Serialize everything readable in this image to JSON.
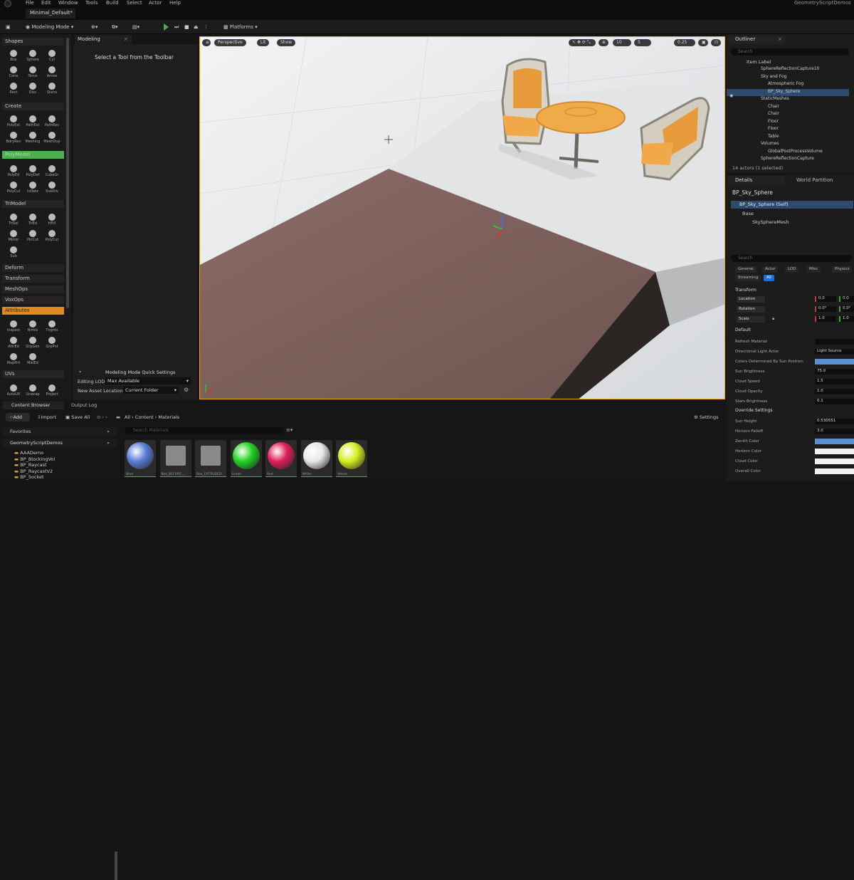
{
  "menubar": {
    "items": [
      "File",
      "Edit",
      "Window",
      "Tools",
      "Build",
      "Select",
      "Actor",
      "Help"
    ],
    "project": "GeometryScriptDemos"
  },
  "tab": {
    "label": "Minimal_Default*"
  },
  "toolbar": {
    "mode": "Modeling Mode",
    "platforms": "Platforms"
  },
  "left": {
    "sections": {
      "shapes": "Shapes",
      "create": "Create",
      "polymodel": "PolyModel",
      "trimodel": "TriModel",
      "deform": "Deform",
      "transform": "Transform",
      "meshops": "MeshOps",
      "voxops": "VoxOps",
      "attributes": "Attributes",
      "uvs": "UVs"
    },
    "shapes": [
      "Box",
      "Sphere",
      "Cyl",
      "Cone",
      "Torus",
      "Arrow",
      "Rect",
      "Disc",
      "Stairs"
    ],
    "create": [
      "PolyExt",
      "PathExt",
      "PathRev",
      "BdryRev",
      "Meshing",
      "MeshDup"
    ],
    "polymodel": [
      "PolyEd",
      "PolyDef",
      "CubeGr",
      "PolyCut",
      "Inflate",
      "SubDiv"
    ],
    "trimodel": [
      "TriSel",
      "TriEd",
      "HFill",
      "Mirror",
      "PlnCut",
      "PolyCut",
      "Sub"
    ],
    "attributes": [
      "Inspect",
      "Nrmls",
      "Tngnts",
      "AttrEd",
      "GrpGen",
      "GrpPnt",
      "MapPnt",
      "MatEd"
    ],
    "uvs": [
      "AutoUV",
      "Unwrap",
      "Project"
    ]
  },
  "modeling": {
    "tab": "Modeling",
    "hint": "Select a Tool from the Toolbar",
    "quick_settings": "Modeling Mode Quick Settings",
    "lod_label": "Editing LOD",
    "lod_value": "Max Available",
    "asset_label": "New Asset Location",
    "asset_value": "Current Folder"
  },
  "viewport": {
    "perspective": "Perspective",
    "lit": "Lit",
    "show": "Show",
    "grid": "10",
    "angle": "5",
    "scale": "0.25"
  },
  "outliner": {
    "title": "Outliner",
    "search": "Search",
    "header": "Item Label",
    "items": [
      {
        "label": "SphereReflectionCapture10",
        "indent": 1
      },
      {
        "label": "Sky and Fog",
        "indent": 1
      },
      {
        "label": "Atmospheric Fog",
        "indent": 2
      },
      {
        "label": "BP_Sky_Sphere",
        "indent": 2
      },
      {
        "label": "StaticMeshes",
        "indent": 1
      },
      {
        "label": "Chair",
        "indent": 2
      },
      {
        "label": "Chair",
        "indent": 2
      },
      {
        "label": "Floor",
        "indent": 2
      },
      {
        "label": "Floor",
        "indent": 2
      },
      {
        "label": "Table",
        "indent": 2
      },
      {
        "label": "Volumes",
        "indent": 1
      },
      {
        "label": "GlobalPostProcessVolume",
        "indent": 2
      },
      {
        "label": "SphereReflectionCapture",
        "indent": 1
      }
    ],
    "status": "14 actors (1 selected)"
  },
  "details": {
    "tab": "Details",
    "tab2": "World Partition",
    "actor": "BP_Sky_Sphere",
    "self": "BP_Sky_Sphere (Self)",
    "base": "Base",
    "mesh": "SkySphereMesh",
    "search": "Search",
    "filters": [
      "General",
      "Actor",
      "LOD",
      "Misc",
      "Physics",
      "Streaming",
      "All"
    ],
    "transform": "Transform",
    "location": "Location",
    "rotation": "Rotation",
    "scale": "Scale",
    "loc_vals": [
      "0.0",
      "0.0"
    ],
    "rot_vals": [
      "0.0°",
      "0.0°"
    ],
    "scale_vals": [
      "1.0",
      "1.0"
    ],
    "default": "Default",
    "rows": [
      {
        "label": "Refresh Material",
        "value": ""
      },
      {
        "label": "Directional Light Actor",
        "value": "Light Source"
      },
      {
        "label": "Colors Determined By Sun Position",
        "value": ""
      },
      {
        "label": "Sun Brightness",
        "value": "75.0"
      },
      {
        "label": "Cloud Speed",
        "value": "1.5"
      },
      {
        "label": "Cloud Opacity",
        "value": "1.0"
      },
      {
        "label": "Stars Brightness",
        "value": "0.1"
      }
    ],
    "override": "Override Settings",
    "override_rows": [
      {
        "label": "Sun Height",
        "value": "0.530551"
      },
      {
        "label": "Horizon Falloff",
        "value": "3.0"
      },
      {
        "label": "Zenith Color",
        "value": ""
      },
      {
        "label": "Horizon Color",
        "value": ""
      },
      {
        "label": "Cloud Color",
        "value": ""
      },
      {
        "label": "Overall Color",
        "value": ""
      }
    ]
  },
  "content_browser": {
    "tab": "Content Browser",
    "tab2": "Output Log",
    "add": "Add",
    "import": "Import",
    "save_all": "Save All",
    "crumbs": [
      "All",
      "Content",
      "Materials"
    ],
    "settings": "Settings",
    "favorites": "Favorites",
    "project": "GeometryScriptDemos",
    "search": "Search Materials",
    "folders": [
      "AAADemo",
      "BP_BlockingVol",
      "BP_Raycast",
      "BP_RaycastV2",
      "BP_Socket"
    ],
    "assets": [
      {
        "name": "Blue",
        "color": "#5a7fd8"
      },
      {
        "name": "Box_BEFORE_...",
        "color": "#8a8a8a"
      },
      {
        "name": "Box_EXTRUDED...",
        "color": "#8a8a8a"
      },
      {
        "name": "Green",
        "color": "#22d422"
      },
      {
        "name": "Red",
        "color": "#e0205a"
      },
      {
        "name": "White",
        "color": "#e8e8e8"
      },
      {
        "name": "Yellow",
        "color": "#d4ef20"
      }
    ]
  }
}
